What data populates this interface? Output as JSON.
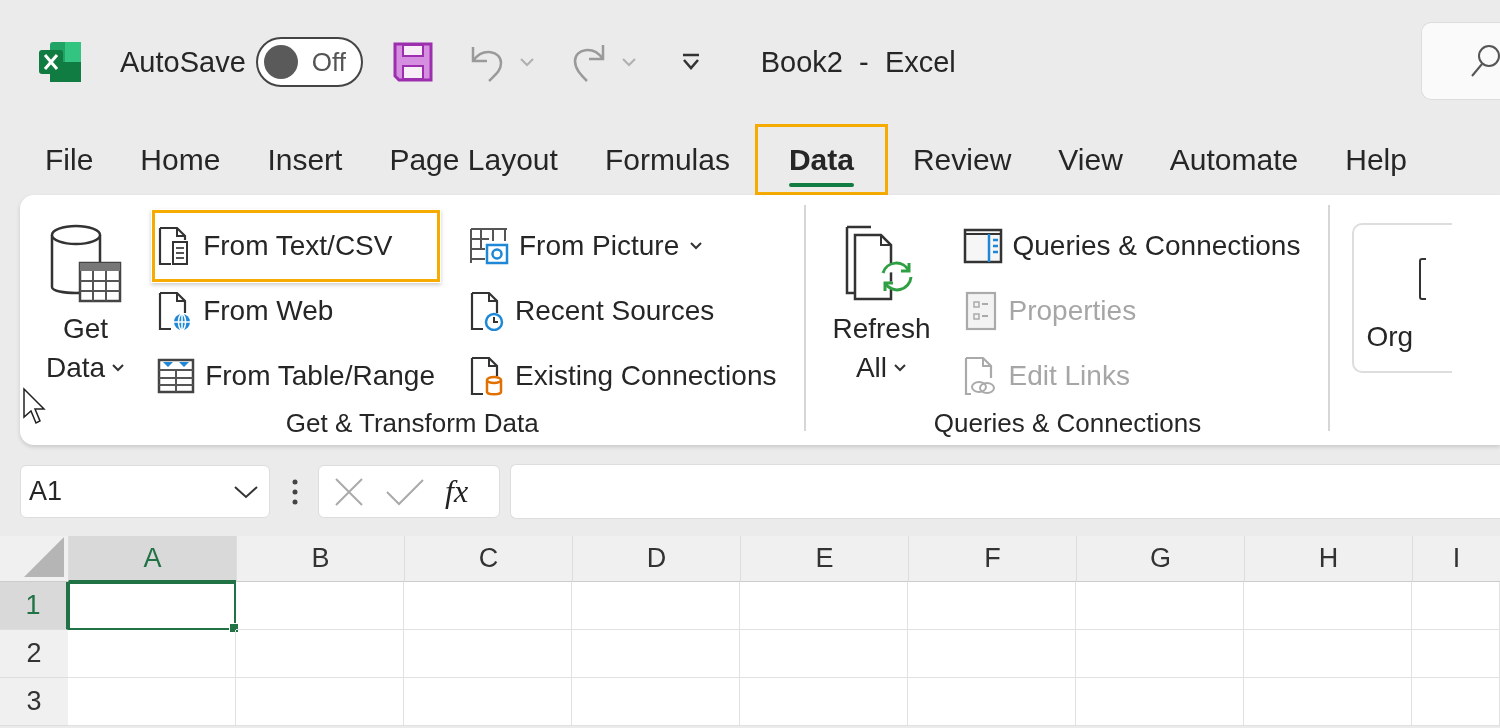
{
  "title_bar": {
    "autosave_label": "AutoSave",
    "autosave": {
      "label": "Off",
      "on": false
    },
    "title": "Book2  -  Excel"
  },
  "tabs": [
    {
      "label": "File",
      "selected": false,
      "highlighted": false
    },
    {
      "label": "Home",
      "selected": false,
      "highlighted": false
    },
    {
      "label": "Insert",
      "selected": false,
      "highlighted": false
    },
    {
      "label": "Page Layout",
      "selected": false,
      "highlighted": false
    },
    {
      "label": "Formulas",
      "selected": false,
      "highlighted": false
    },
    {
      "label": "Data",
      "selected": true,
      "highlighted": true
    },
    {
      "label": "Review",
      "selected": false,
      "highlighted": false
    },
    {
      "label": "View",
      "selected": false,
      "highlighted": false
    },
    {
      "label": "Automate",
      "selected": false,
      "highlighted": false
    },
    {
      "label": "Help",
      "selected": false,
      "highlighted": false
    }
  ],
  "ribbon": {
    "groups": [
      {
        "label": "Get & Transform Data",
        "large_button": {
          "kind": "database",
          "lines": [
            "Get",
            "Data"
          ],
          "dropdown": true
        },
        "columns": [
          [
            {
              "label": "From Text/CSV",
              "kind": "text-file",
              "highlighted": true,
              "disabled": false,
              "dropdown": false
            },
            {
              "label": "From Web",
              "kind": "web-file",
              "highlighted": false,
              "disabled": false,
              "dropdown": false
            },
            {
              "label": "From Table/Range",
              "kind": "table",
              "highlighted": false,
              "disabled": false,
              "dropdown": false
            }
          ],
          [
            {
              "label": "From Picture",
              "kind": "picture",
              "highlighted": false,
              "disabled": false,
              "dropdown": true
            },
            {
              "label": "Recent Sources",
              "kind": "clock-file",
              "highlighted": false,
              "disabled": false,
              "dropdown": false
            },
            {
              "label": "Existing Connections",
              "kind": "db-file",
              "highlighted": false,
              "disabled": false,
              "dropdown": false
            }
          ]
        ]
      },
      {
        "label": "Queries & Connections",
        "large_button": {
          "kind": "refresh",
          "lines": [
            "Refresh",
            "All"
          ],
          "dropdown": true
        },
        "columns": [
          [
            {
              "label": "Queries & Connections",
              "kind": "pane",
              "highlighted": false,
              "disabled": false,
              "dropdown": false
            },
            {
              "label": "Properties",
              "kind": "properties",
              "highlighted": false,
              "disabled": true,
              "dropdown": false
            },
            {
              "label": "Edit Links",
              "kind": "link-file",
              "highlighted": false,
              "disabled": true,
              "dropdown": false
            }
          ]
        ]
      }
    ],
    "partial_button": {
      "label": "Org"
    }
  },
  "formula_bar": {
    "name_box": "A1",
    "fx": "fx"
  },
  "sheet": {
    "columns": [
      {
        "label": "A",
        "selected": true
      },
      {
        "label": "B",
        "selected": false
      },
      {
        "label": "C",
        "selected": false
      },
      {
        "label": "D",
        "selected": false
      },
      {
        "label": "E",
        "selected": false
      },
      {
        "label": "F",
        "selected": false
      },
      {
        "label": "G",
        "selected": false
      },
      {
        "label": "H",
        "selected": false
      },
      {
        "label": "I",
        "selected": false
      }
    ],
    "rows": [
      {
        "label": "1",
        "selected": true
      },
      {
        "label": "2",
        "selected": false
      },
      {
        "label": "3",
        "selected": false
      }
    ]
  }
}
